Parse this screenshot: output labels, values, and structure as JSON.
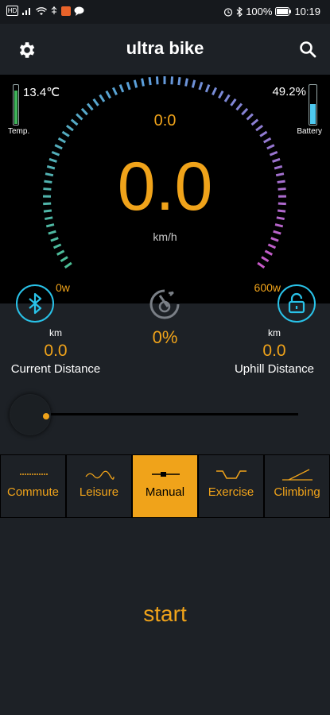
{
  "statusbar": {
    "left_icons": [
      "hd-icon",
      "signal-icon",
      "wifi-icon",
      "usb-icon",
      "app-icon",
      "chat-icon"
    ],
    "battery": "100%",
    "time": "10:19"
  },
  "appbar": {
    "title": "ultra bike"
  },
  "dashboard": {
    "temperature": "13.4℃",
    "temperature_label": "Temp.",
    "temperature_level": 0.85,
    "battery": "49.2%",
    "battery_label": "Battery",
    "battery_level": 0.492,
    "timer": "0:0",
    "speed": "0.0",
    "speed_unit": "km/h",
    "power_min": "0w",
    "power_max": "600w"
  },
  "assist": {
    "percent": "0%"
  },
  "distances": {
    "current": {
      "unit": "km",
      "value": "0.0",
      "label": "Current Distance"
    },
    "uphill": {
      "unit": "km",
      "value": "0.0",
      "label": "Uphill Distance"
    }
  },
  "modes": [
    {
      "label": "Commute",
      "active": false,
      "icon": "commute-icon"
    },
    {
      "label": "Leisure",
      "active": false,
      "icon": "leisure-icon"
    },
    {
      "label": "Manual",
      "active": true,
      "icon": "manual-icon"
    },
    {
      "label": "Exercise",
      "active": false,
      "icon": "exercise-icon"
    },
    {
      "label": "Climbing",
      "active": false,
      "icon": "climbing-icon"
    }
  ],
  "start_label": "start",
  "colors": {
    "accent": "#f0a31a",
    "background": "#1d2126",
    "dashboard": "#000000",
    "cyan": "#29c2e8"
  }
}
